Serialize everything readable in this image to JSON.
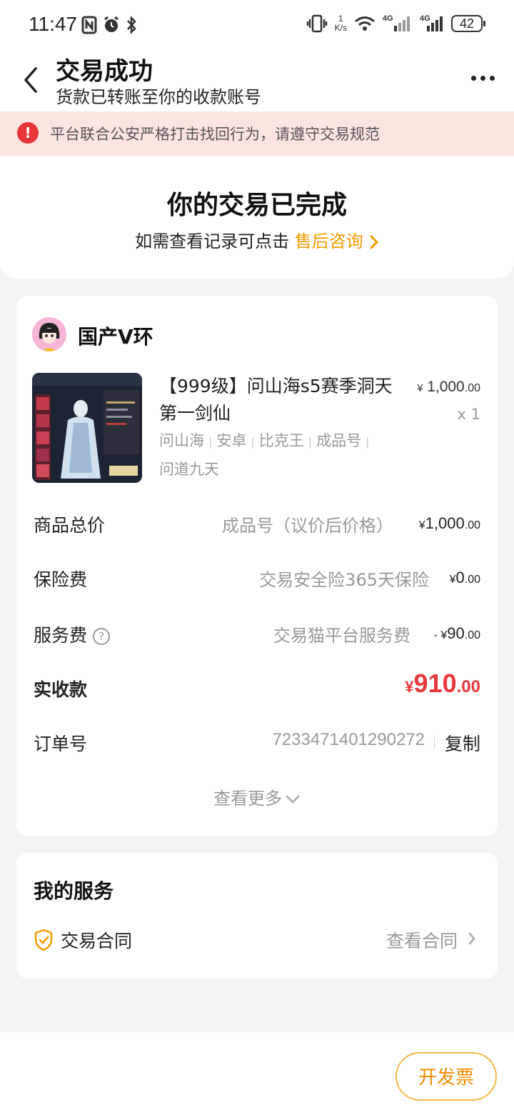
{
  "status_bar": {
    "time": "11:47",
    "net_speed_top": "1",
    "net_speed_unit": "K/s",
    "signal1_label": "4G",
    "signal2_label": "4G",
    "battery": "42"
  },
  "header": {
    "title": "交易成功",
    "subtitle": "货款已转账至你的收款账号"
  },
  "notice": {
    "icon_text": "!",
    "text": "平台联合公安严格打击找回行为，请遵守交易规范"
  },
  "completion": {
    "title": "你的交易已完成",
    "prompt": "如需查看记录可点击",
    "link": "售后咨询"
  },
  "seller": {
    "name": "国产V环"
  },
  "product": {
    "title": "【999级】问山海s5赛季洞天第一剑仙",
    "price_symbol": "¥",
    "price_main": "1,000",
    "price_cents": ".00",
    "quantity": "x 1",
    "tags": [
      "问山海",
      "安卓",
      "比克王",
      "成品号",
      "问道九天"
    ]
  },
  "summary": {
    "goods_total": {
      "label": "商品总价",
      "desc": "成品号（议价后价格）",
      "prefix": "¥",
      "main": "1,000",
      "cents": ".00"
    },
    "insurance": {
      "label": "保险费",
      "desc": "交易安全险365天保险",
      "prefix": "¥",
      "main": "0",
      "cents": ".00"
    },
    "service_fee": {
      "label": "服务费",
      "help": "?",
      "desc": "交易猫平台服务费",
      "prefix": "- ¥",
      "main": "90",
      "cents": ".00"
    },
    "received": {
      "label": "实收款",
      "prefix": "¥",
      "main": "910",
      "cents": ".00"
    },
    "order_no": {
      "label": "订单号",
      "value": "7233471401290272",
      "copy": "复制"
    },
    "see_more": "查看更多"
  },
  "services": {
    "title": "我的服务",
    "contract_label": "交易合同",
    "contract_link": "查看合同"
  },
  "bottom": {
    "invoice_button": "开发票"
  },
  "colors": {
    "accent_orange": "#f59b00",
    "price_red": "#e8373a",
    "notice_bg": "#fde4e1"
  }
}
